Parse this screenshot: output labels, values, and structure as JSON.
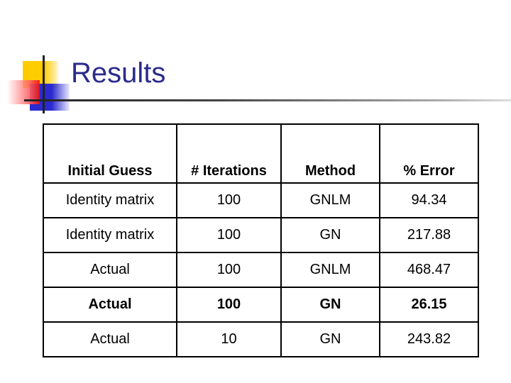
{
  "slide": {
    "title": "Results"
  },
  "table": {
    "headers": [
      "Initial Guess",
      "# Iterations",
      "Method",
      "% Error"
    ],
    "rows": [
      {
        "initial_guess": "Identity matrix",
        "iterations": "100",
        "method": "GNLM",
        "error": "94.34",
        "bold": false
      },
      {
        "initial_guess": "Identity matrix",
        "iterations": "100",
        "method": "GN",
        "error": "217.88",
        "bold": false
      },
      {
        "initial_guess": "Actual",
        "iterations": "100",
        "method": "GNLM",
        "error": "468.47",
        "bold": false
      },
      {
        "initial_guess": "Actual",
        "iterations": "100",
        "method": "GN",
        "error": "26.15",
        "bold": true
      },
      {
        "initial_guess": "Actual",
        "iterations": "10",
        "method": "GN",
        "error": "243.82",
        "bold": false
      }
    ]
  },
  "colors": {
    "title": "#2b2b8c",
    "accent_yellow": "#ffcc00",
    "accent_blue": "#2a2ad0",
    "accent_red": "#ee1111"
  }
}
